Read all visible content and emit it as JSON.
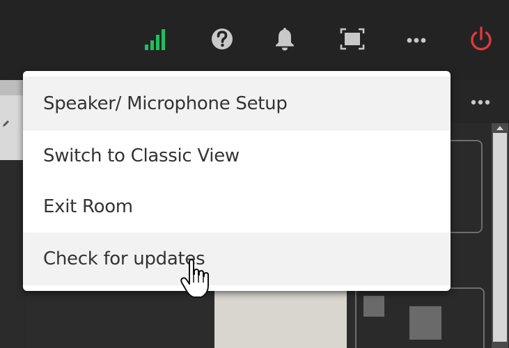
{
  "toolbar": {
    "icons": [
      {
        "name": "signal-strength-icon",
        "color": "#1fbf5f"
      },
      {
        "name": "help-icon",
        "color": "#c8c8c8"
      },
      {
        "name": "notifications-bell-icon",
        "color": "#c8c8c8"
      },
      {
        "name": "fullscreen-icon",
        "color": "#c8c8c8"
      },
      {
        "name": "more-options-icon",
        "color": "#c8c8c8"
      },
      {
        "name": "power-icon",
        "color": "#e0393e"
      }
    ]
  },
  "menu": {
    "items": [
      {
        "label": "Speaker/ Microphone Setup",
        "highlighted": true
      },
      {
        "label": "Switch to Classic View",
        "highlighted": false
      },
      {
        "label": "Exit Room",
        "highlighted": false
      },
      {
        "label": "Check for updates",
        "highlighted": true
      }
    ]
  },
  "right_panel": {
    "icon": "more-options-icon"
  },
  "colors": {
    "toolbar_bg": "#232323",
    "menu_bg": "#ffffff",
    "menu_text": "#333333",
    "accent_green": "#1fbf5f",
    "accent_red": "#e0393e"
  }
}
